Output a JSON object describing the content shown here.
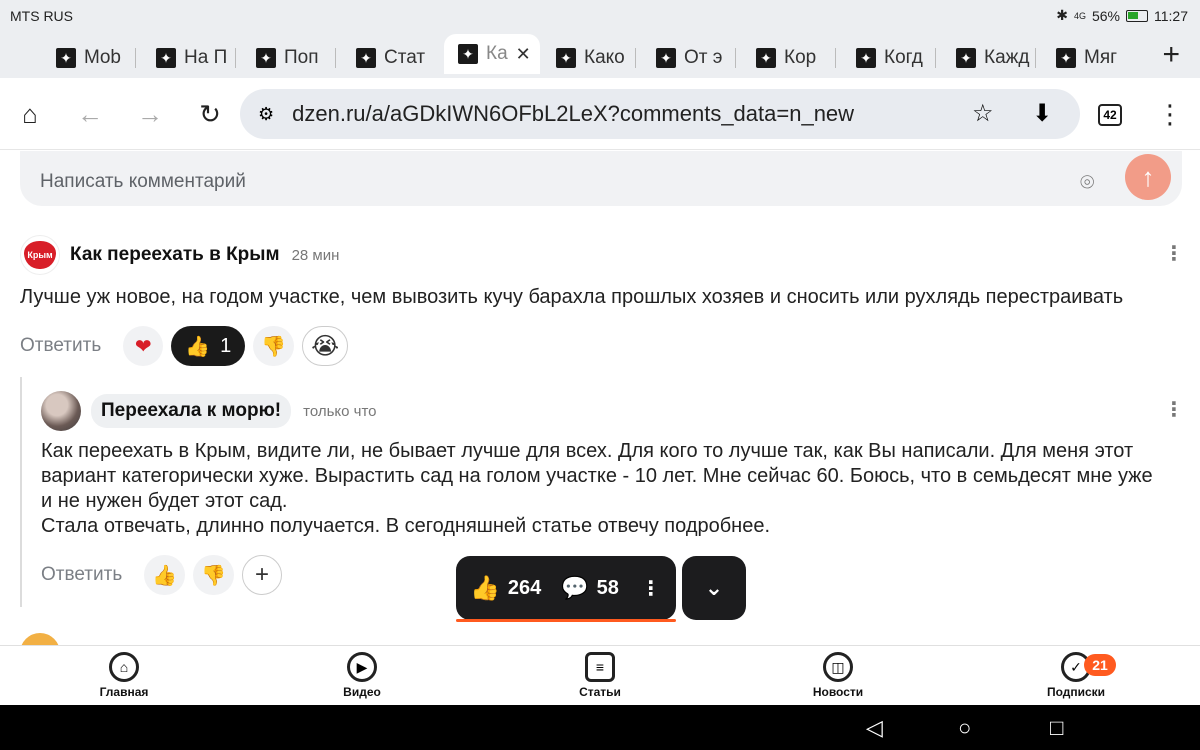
{
  "status": {
    "carrier": "MTS RUS",
    "battery": "56%",
    "time": "11:27",
    "signal": "4G"
  },
  "tabs": [
    {
      "label": "Mob"
    },
    {
      "label": "На П"
    },
    {
      "label": "Поп"
    },
    {
      "label": "Стат"
    },
    {
      "label": "Ка",
      "active": true,
      "close": "✕"
    },
    {
      "label": "Како"
    },
    {
      "label": "От э"
    },
    {
      "label": "Кор"
    },
    {
      "label": "Когд"
    },
    {
      "label": "Кажд"
    },
    {
      "label": "Мяг"
    }
  ],
  "tab_add": "+",
  "toolbar": {
    "url": "dzen.ru/a/aGDkIWN6OFbL2LeX?comments_data=n_new",
    "tab_count": "42"
  },
  "comment_input": {
    "placeholder": "Написать комментарий"
  },
  "comments": [
    {
      "author": "Как переехать в Крым",
      "avatar_text": "Крым",
      "time": "28 мин",
      "text": "Лучше уж новое, на годом участке, чем вывозить кучу барахла прошлых хозяев и сносить или рухлядь перестраивать",
      "reply_label": "Ответить",
      "like_count": "1"
    },
    {
      "author": "Переехала к морю!",
      "time": "только что",
      "text_lines": [
        "Как переехать в Крым, видите ли, не бывает лучше для всех. Для кого то лучше так, как Вы написали. Для меня этот",
        "вариант категорически хуже. Вырастить сад на голом участке - 10 лет. Мне сейчас 60. Боюсь, что в семьдесят мне уже",
        "и не нужен будет этот сад.",
        "Стала отвечать, длинно получается. В сегодняшней статье отвечу подробнее."
      ],
      "reply_label": "Ответить",
      "add": "+"
    }
  ],
  "floating": {
    "likes": "264",
    "comments": "58"
  },
  "bottom_nav": [
    {
      "label": "Главная"
    },
    {
      "label": "Видео"
    },
    {
      "label": "Статьи"
    },
    {
      "label": "Новости"
    },
    {
      "label": "Подписки",
      "badge": "21"
    }
  ],
  "colors": {
    "accent": "#ff5a1f",
    "send_button": "#f29c88",
    "dark_pill": "#1c1c1e"
  }
}
